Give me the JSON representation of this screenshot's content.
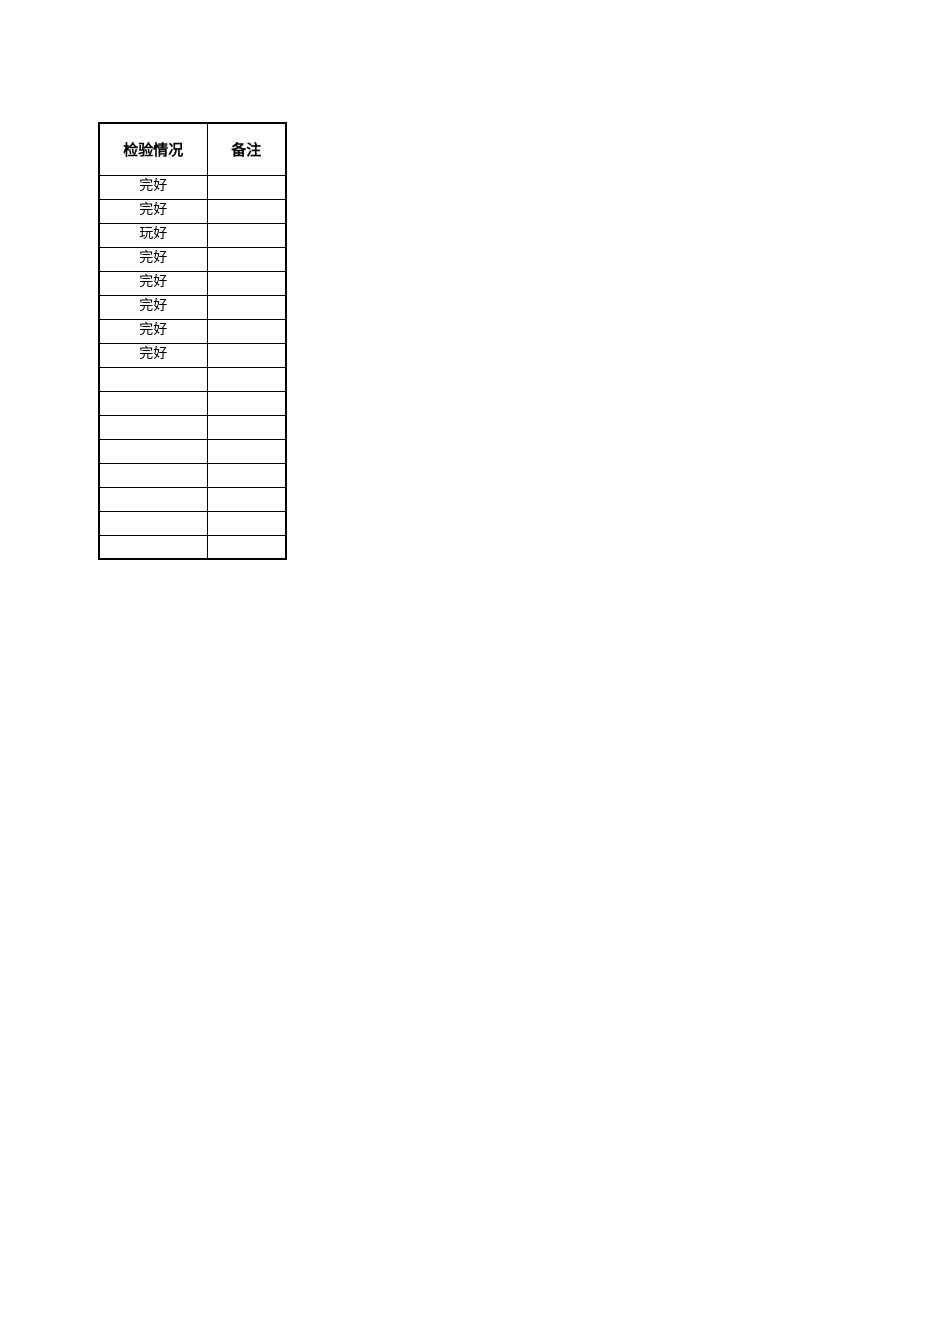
{
  "table": {
    "headers": {
      "status": "检验情况",
      "remark": "备注"
    },
    "rows": [
      {
        "status": "完好",
        "remark": ""
      },
      {
        "status": "完好",
        "remark": ""
      },
      {
        "status": "玩好",
        "remark": ""
      },
      {
        "status": "完好",
        "remark": ""
      },
      {
        "status": "完好",
        "remark": ""
      },
      {
        "status": "完好",
        "remark": ""
      },
      {
        "status": "完好",
        "remark": ""
      },
      {
        "status": "完好",
        "remark": ""
      },
      {
        "status": "",
        "remark": ""
      },
      {
        "status": "",
        "remark": ""
      },
      {
        "status": "",
        "remark": ""
      },
      {
        "status": "",
        "remark": ""
      },
      {
        "status": "",
        "remark": ""
      },
      {
        "status": "",
        "remark": ""
      },
      {
        "status": "",
        "remark": ""
      },
      {
        "status": "",
        "remark": ""
      }
    ]
  }
}
